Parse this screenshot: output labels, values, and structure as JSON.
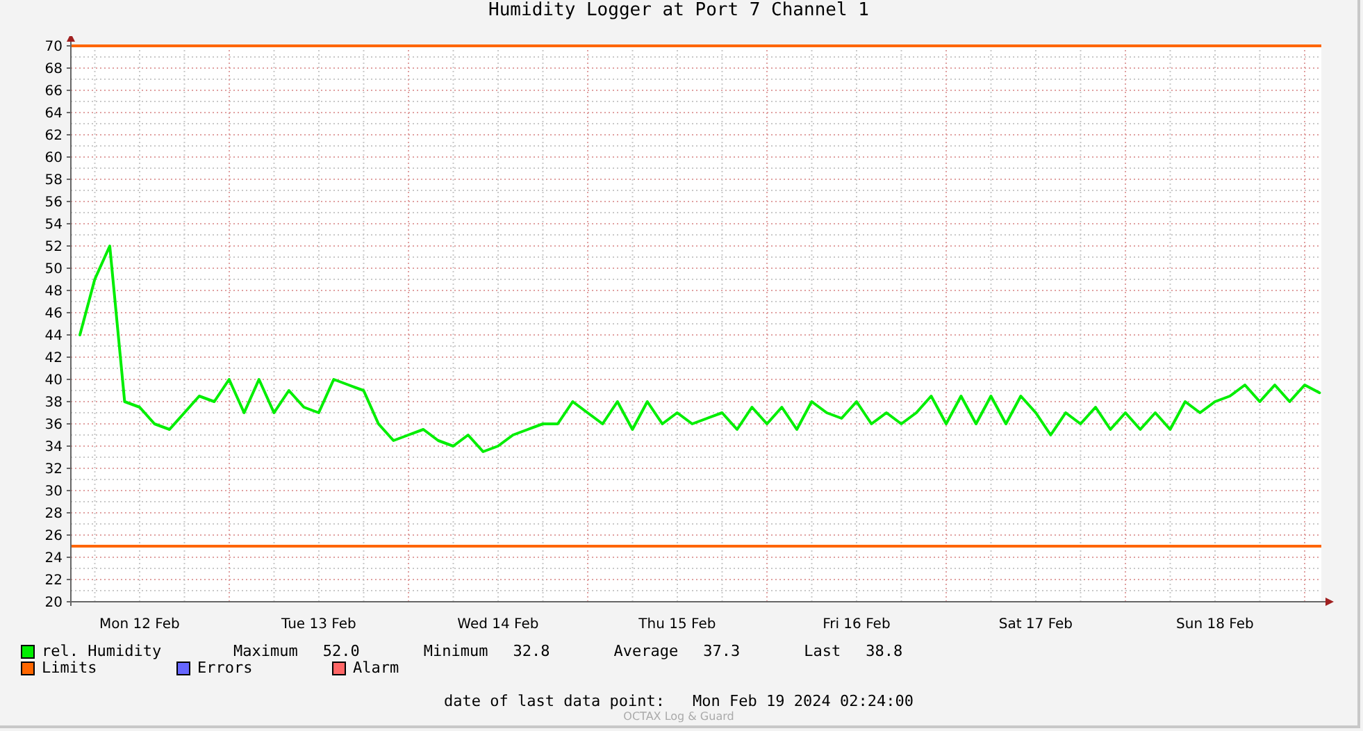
{
  "title": "Humidity Logger at Port 7 Channel 1",
  "chart": {
    "chart_data": {
      "type": "line",
      "ylim": [
        20,
        70
      ],
      "yticks": [
        20,
        22,
        24,
        26,
        28,
        30,
        32,
        34,
        36,
        38,
        40,
        42,
        44,
        46,
        48,
        50,
        52,
        54,
        56,
        58,
        60,
        62,
        64,
        66,
        68,
        70
      ],
      "categories": [
        null,
        null,
        null,
        null,
        "Mon 12 Feb",
        null,
        null,
        null,
        null,
        null,
        null,
        null,
        null,
        null,
        null,
        null,
        "Tue 13 Feb",
        null,
        null,
        null,
        null,
        null,
        null,
        null,
        null,
        null,
        null,
        null,
        "Wed 14 Feb",
        null,
        null,
        null,
        null,
        null,
        null,
        null,
        null,
        null,
        null,
        null,
        "Thu 15 Feb",
        null,
        null,
        null,
        null,
        null,
        null,
        null,
        null,
        null,
        null,
        null,
        "Fri 16 Feb",
        null,
        null,
        null,
        null,
        null,
        null,
        null,
        null,
        null,
        null,
        null,
        "Sat 17 Feb",
        null,
        null,
        null,
        null,
        null,
        null,
        null,
        null,
        null,
        null,
        null,
        "Sun 18 Feb",
        null,
        null,
        null,
        null,
        null,
        null,
        null
      ],
      "series": [
        {
          "name": "rel. Humidity",
          "color": "#00ee00",
          "values": [
            44,
            49,
            52,
            38,
            37.5,
            36,
            35.5,
            37,
            38.5,
            38,
            40,
            37,
            40,
            37,
            39,
            37.5,
            37,
            40,
            39.5,
            39,
            36,
            34.5,
            35,
            35.5,
            34.5,
            34,
            35,
            33.5,
            34,
            35,
            35.5,
            36,
            36,
            38,
            37,
            36,
            38,
            35.5,
            38,
            36,
            37,
            36,
            36.5,
            37,
            35.5,
            37.5,
            36,
            37.5,
            35.5,
            38,
            37,
            36.5,
            38,
            36,
            37,
            36,
            37,
            38.5,
            36,
            38.5,
            36,
            38.5,
            36,
            38.5,
            37,
            35,
            37,
            36,
            37.5,
            35.5,
            37,
            35.5,
            37,
            35.5,
            38,
            37,
            38,
            38.5,
            39.5,
            38,
            39.5,
            38,
            39.5,
            38.8
          ]
        }
      ],
      "grid": true,
      "ref_lines": [
        {
          "axis": "y",
          "value": 70,
          "color": "#ff6600"
        },
        {
          "axis": "y",
          "value": 25,
          "color": "#ff6600"
        }
      ]
    }
  },
  "legend": {
    "stats": [
      {
        "label": "Maximum",
        "value": "52.0"
      },
      {
        "label": "Minimum",
        "value": "32.8"
      },
      {
        "label": "Average",
        "value": "37.3"
      },
      {
        "label": "Last",
        "value": "38.8"
      }
    ],
    "items": [
      {
        "label": "Limits",
        "color": "#ff6600"
      },
      {
        "label": "Errors",
        "color": "#6666ff"
      },
      {
        "label": "Alarm",
        "color": "#ff6666"
      }
    ]
  },
  "footer": {
    "label": "date of last data point:",
    "value": "Mon Feb 19 2024 02:24:00",
    "watermark": "OCTAX Log & Guard"
  }
}
